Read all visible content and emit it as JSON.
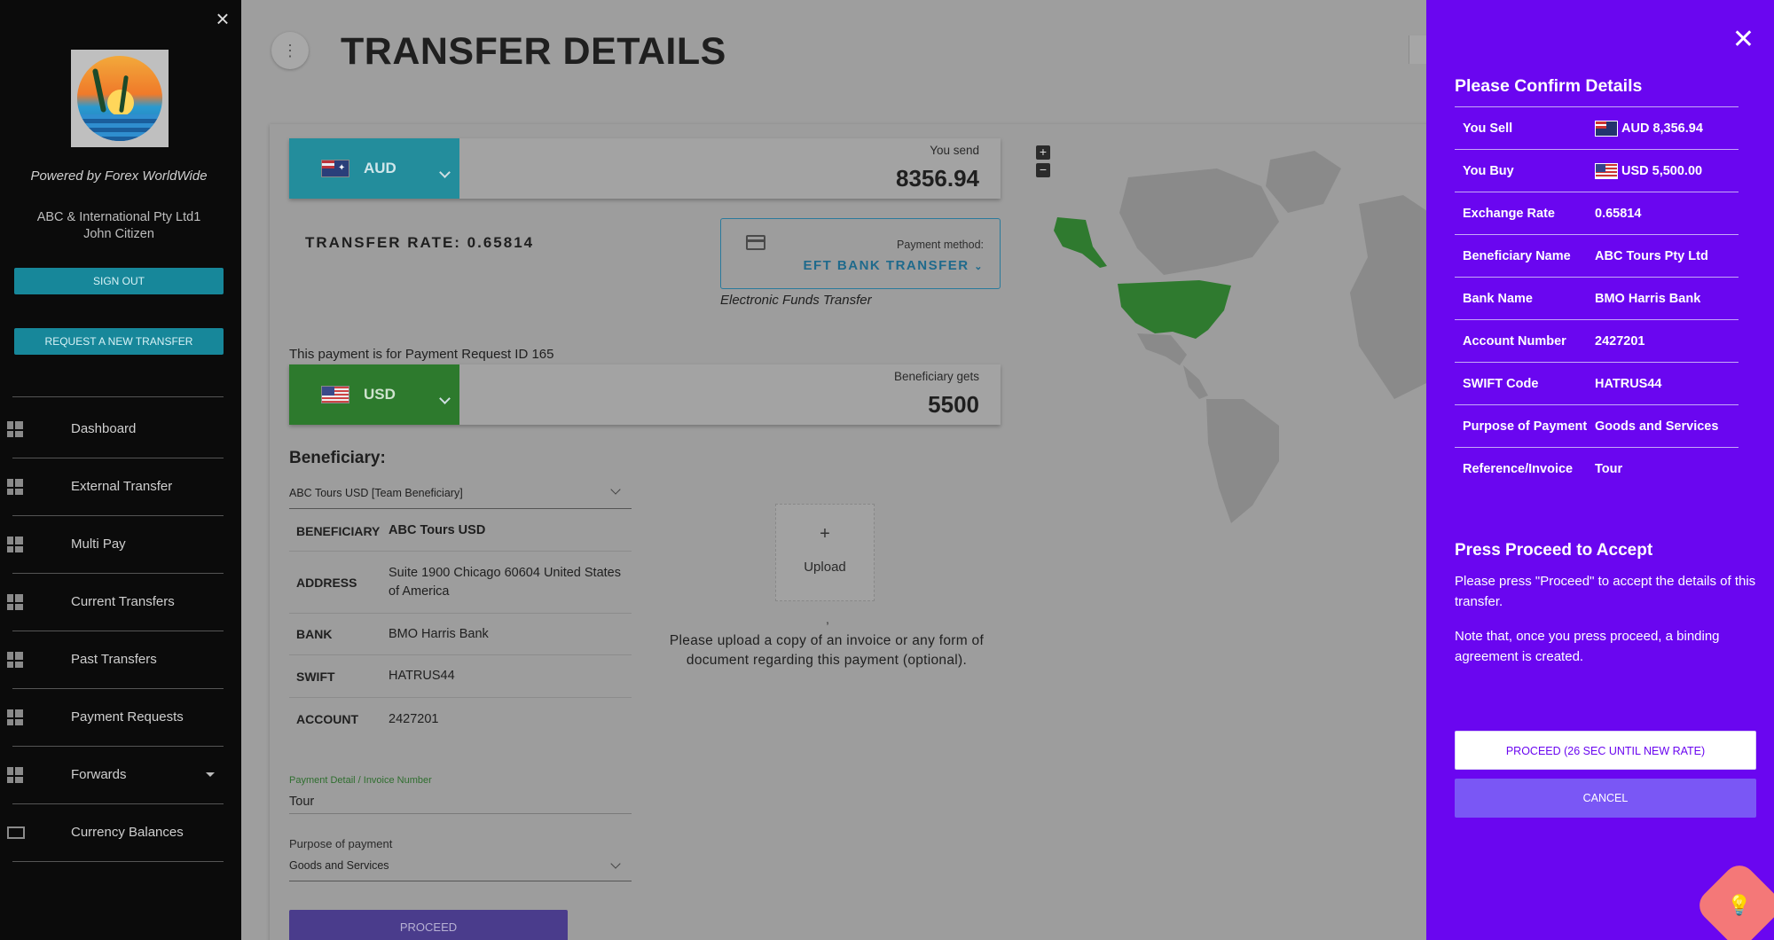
{
  "sidebar": {
    "powered_by": "Powered by Forex WorldWide",
    "company": "ABC & International Pty Ltd1",
    "user": "John Citizen",
    "sign_out": "SIGN OUT",
    "request_transfer": "REQUEST A NEW TRANSFER",
    "nav": [
      {
        "label": "Dashboard",
        "icon": "dashboard-icon"
      },
      {
        "label": "External Transfer",
        "icon": "dashboard-icon"
      },
      {
        "label": "Multi Pay",
        "icon": "dashboard-icon"
      },
      {
        "label": "Current Transfers",
        "icon": "dashboard-icon"
      },
      {
        "label": "Past Transfers",
        "icon": "dashboard-icon"
      },
      {
        "label": "Payment Requests",
        "icon": "dashboard-icon"
      },
      {
        "label": "Forwards",
        "icon": "dashboard-icon"
      },
      {
        "label": "Currency Balances",
        "icon": "cash-icon"
      }
    ]
  },
  "main": {
    "title": "TRANSFER DETAILS",
    "send": {
      "currency": "AUD",
      "label": "You send",
      "amount": "8356.94"
    },
    "rate_text": "TRANSFER RATE: 0.65814",
    "payment_method": {
      "label": "Payment method:",
      "value": "EFT BANK TRANSFER",
      "description": "Electronic Funds Transfer"
    },
    "payment_request_text": "This payment is for Payment Request ID 165",
    "receive": {
      "currency": "USD",
      "label": "Beneficiary gets",
      "amount": "5500"
    },
    "beneficiary_heading": "Beneficiary:",
    "beneficiary_select": "ABC Tours USD [Team Beneficiary]",
    "beneficiary_table": [
      {
        "key": "BENEFICIARY",
        "value": "ABC Tours USD"
      },
      {
        "key": "ADDRESS",
        "value": "Suite 1900 Chicago 60604 United States of America"
      },
      {
        "key": "BANK",
        "value": "BMO Harris Bank"
      },
      {
        "key": "SWIFT",
        "value": "HATRUS44"
      },
      {
        "key": "ACCOUNT",
        "value": "2427201"
      }
    ],
    "upload_plus": "+",
    "upload_label": "Upload",
    "upload_comma": ",",
    "upload_note": "Please upload a copy of an invoice or any form of document regarding this payment (optional).",
    "payment_detail_label": "Payment Detail / Invoice Number",
    "payment_detail_value": "Tour",
    "purpose_label": "Purpose of payment",
    "purpose_value": "Goods and Services",
    "proceed": "PROCEED",
    "zoom_in": "+",
    "zoom_out": "−"
  },
  "panel": {
    "title": "Please Confirm Details",
    "rows": [
      {
        "key": "You Sell",
        "value": "AUD 8,356.94",
        "flag": "au"
      },
      {
        "key": "You Buy",
        "value": "USD 5,500.00",
        "flag": "us"
      },
      {
        "key": "Exchange Rate",
        "value": "0.65814"
      },
      {
        "key": "Beneficiary Name",
        "value": "ABC Tours Pty Ltd"
      },
      {
        "key": "Bank Name",
        "value": "BMO Harris Bank"
      },
      {
        "key": "Account Number",
        "value": "2427201"
      },
      {
        "key": "SWIFT Code",
        "value": "HATRUS44"
      },
      {
        "key": "Purpose of Payment",
        "value": "Goods and Services"
      },
      {
        "key": "Reference/Invoice",
        "value": "Tour"
      }
    ],
    "accept_title": "Press Proceed to Accept",
    "accept_text_1": "Please press \"Proceed\" to accept the details of this transfer.",
    "accept_text_2": "Note that, once you press proceed, a binding agreement is created.",
    "proceed_btn": "PROCEED (26 SEC UNTIL NEW RATE)",
    "cancel_btn": "CANCEL"
  },
  "colors": {
    "panel_bg": "#6a06f0",
    "aud_bg": "#238d9c",
    "usd_bg": "#2d7a2d",
    "sidebar_btn": "#17879a"
  }
}
